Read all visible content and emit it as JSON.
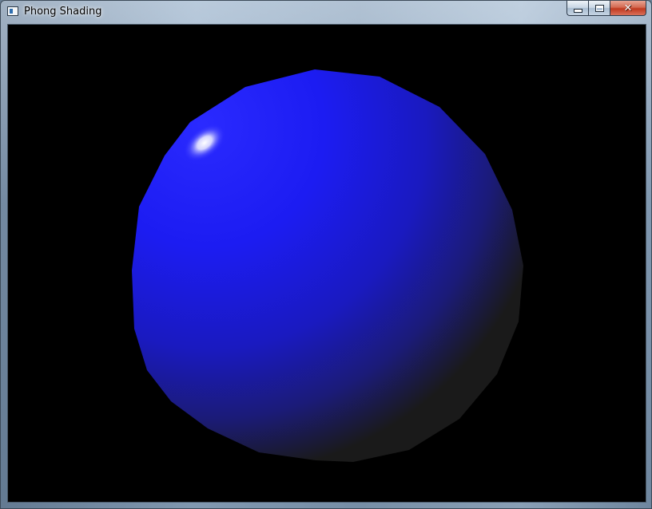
{
  "window": {
    "title": "Phong Shading",
    "controls": {
      "minimize": "minimize-icon",
      "maximize": "maximize-icon",
      "close": "close-icon"
    }
  },
  "scene": {
    "background_color": "#000000",
    "sphere_color": "#1a1aff",
    "highlight_color": "#ffffff",
    "shadow_color": "#1a1a1a"
  }
}
